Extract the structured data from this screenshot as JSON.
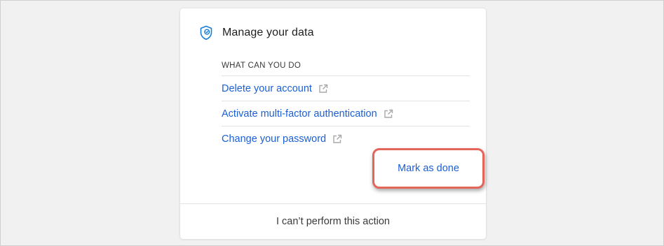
{
  "card": {
    "title": "Manage your data",
    "section_label": "WHAT CAN YOU DO",
    "links": [
      {
        "label": "Delete your account",
        "icon": "external-link-icon"
      },
      {
        "label": "Activate multi-factor authentication",
        "icon": "external-link-icon"
      },
      {
        "label": "Change your password",
        "icon": "external-link-icon"
      }
    ],
    "mark_done_label": "Mark as done",
    "footer_label": "I can’t perform this action",
    "header_icon": "shield-check-icon"
  },
  "colors": {
    "link": "#1a5fd6",
    "highlight": "#e4655a",
    "background": "#f1f1f1"
  }
}
